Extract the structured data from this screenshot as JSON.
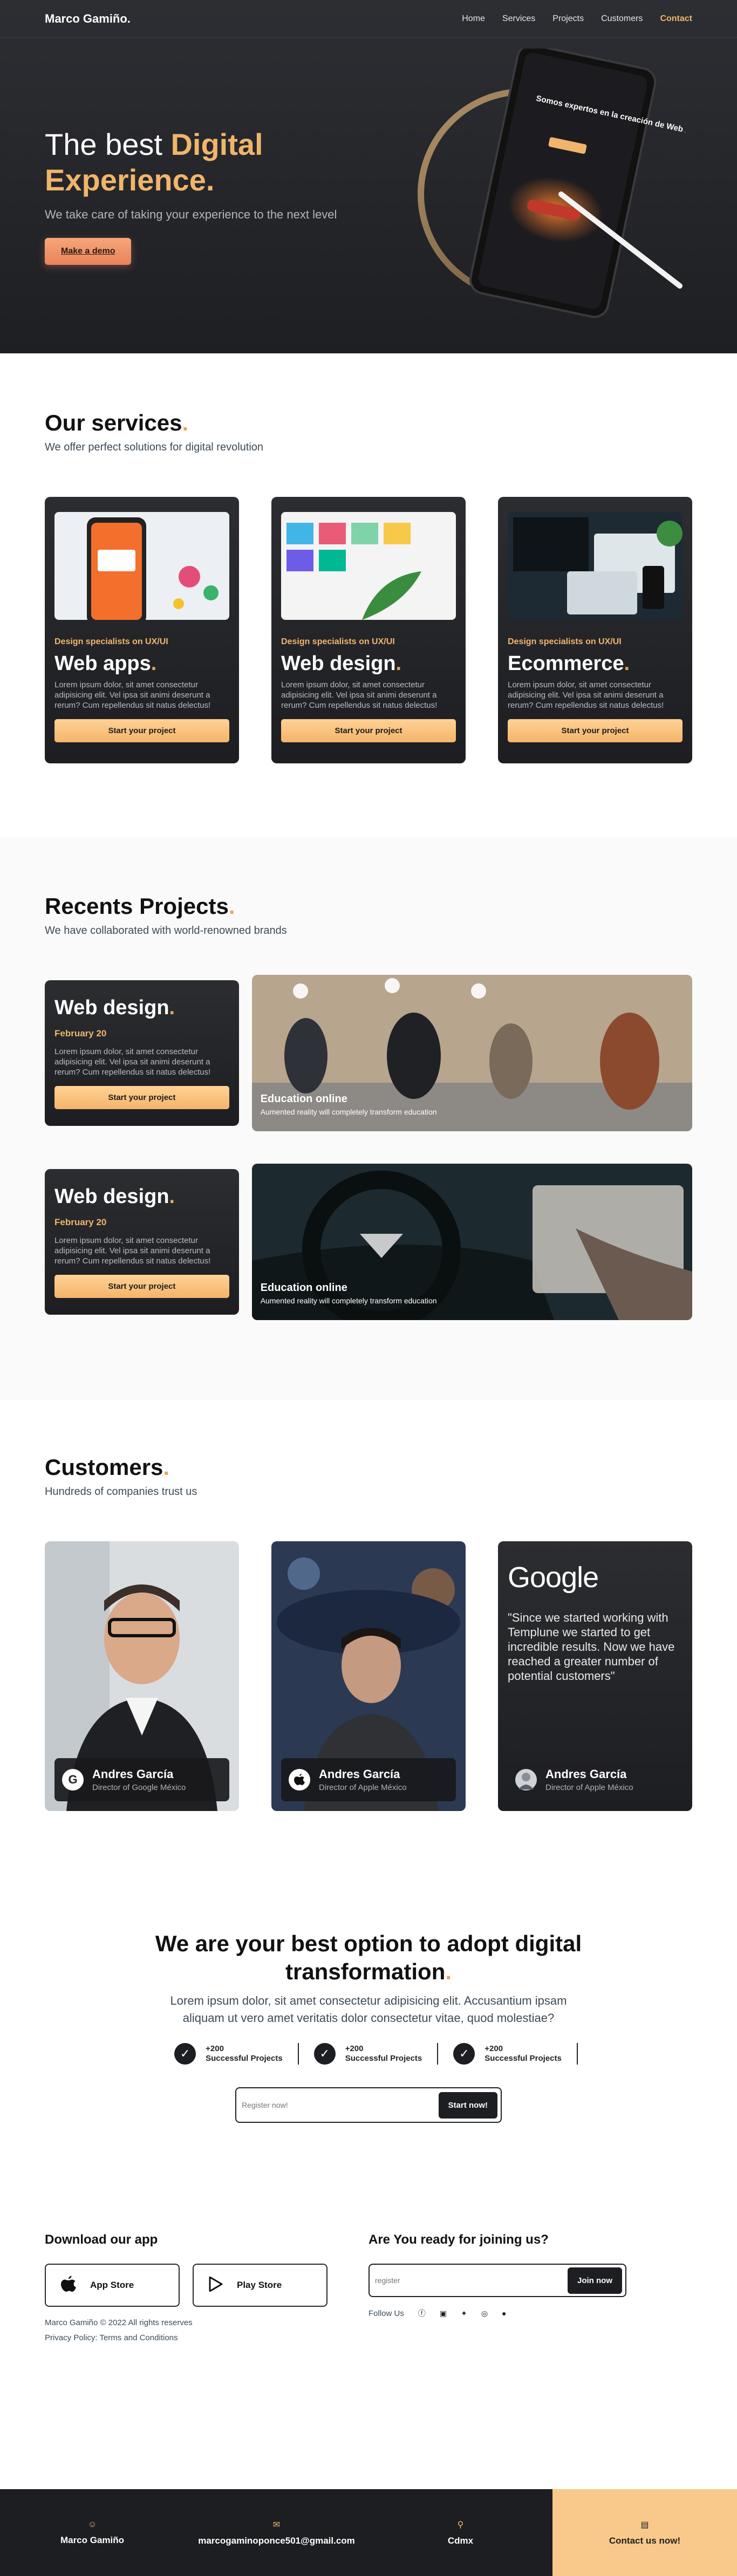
{
  "nav": {
    "brand": "Marco Gamiño.",
    "links": [
      "Home",
      "Services",
      "Projects",
      "Customers"
    ],
    "contact": "Contact"
  },
  "hero": {
    "title_plain": "The best ",
    "title_accent": "Digital Experience.",
    "subtitle": "We take care of taking your experience to the next level",
    "cta": "Make a demo",
    "tablet_text": "Somos expertos en la creación de Web Apps."
  },
  "services": {
    "title": "Our services",
    "subtitle": "We offer perfect solutions for digital revolution",
    "items": [
      {
        "kicker": "Design specialists on UX/UI",
        "title": "Web apps",
        "desc": "Lorem ipsum dolor, sit amet consectetur adipisicing elit. Vel ipsa sit animi deserunt a rerum? Cum repellendus sit natus delectus!",
        "button": "Start your project"
      },
      {
        "kicker": "Design specialists on UX/UI",
        "title": "Web design",
        "desc": "Lorem ipsum dolor, sit amet consectetur adipisicing elit. Vel ipsa sit animi deserunt a rerum? Cum repellendus sit natus delectus!",
        "button": "Start your project"
      },
      {
        "kicker": "Design specialists on UX/UI",
        "title": "Ecommerce",
        "desc": "Lorem ipsum dolor, sit amet consectetur adipisicing elit. Vel ipsa sit animi deserunt a rerum? Cum repellendus sit natus delectus!",
        "button": "Start your project"
      }
    ]
  },
  "projects": {
    "title": "Recents Projects",
    "subtitle": "We have collaborated with world-renowned brands",
    "items": [
      {
        "title": "Web design",
        "date": "February 20",
        "desc": "Lorem ipsum dolor, sit amet consectetur adipisicing elit. Vel ipsa sit animi deserunt a rerum? Cum repellendus sit natus delectus!",
        "button": "Start your project",
        "caption_title": "Education online",
        "caption_sub": "Aumented reality will completely transform education"
      },
      {
        "title": "Web design",
        "date": "February 20",
        "desc": "Lorem ipsum dolor, sit amet consectetur adipisicing elit. Vel ipsa sit animi deserunt a rerum? Cum repellendus sit natus delectus!",
        "button": "Start your project",
        "caption_title": "Education online",
        "caption_sub": "Aumented reality will completely transform education"
      }
    ]
  },
  "customers": {
    "title": "Customers",
    "subtitle": "Hundreds of companies trust us",
    "items": [
      {
        "name": "Andres García",
        "role": "Director of Google México",
        "logo": "G"
      },
      {
        "name": "Andres García",
        "role": "Director of Apple México",
        "logo": ""
      }
    ],
    "quote_card": {
      "brand": "Google",
      "quote": "\"Since we started working with Templune we started to get incredible results. Now we have reached a greater number of potential customers\"",
      "name": "Andres García",
      "role": "Director of Apple México"
    }
  },
  "cta": {
    "title": "We are your best option to adopt digital transformation",
    "subtitle": "Lorem ipsum dolor, sit amet consectetur adipisicing elit. Accusantium ipsam aliquam ut vero amet veritatis dolor consectetur vitae, quod molestiae?",
    "stats": [
      {
        "value": "+200",
        "label": "Successful Projects"
      },
      {
        "value": "+200",
        "label": "Successful Projects"
      },
      {
        "value": "+200",
        "label": "Successful Projects"
      }
    ],
    "input_placeholder": "Register now!",
    "button": "Start now!"
  },
  "footer": {
    "download_title": "Download our app",
    "app_store": "App Store",
    "play_store": "Play Store",
    "copyright": "Marco Gamiño © 2022 All rights reserves",
    "privacy": "Privacy Policy",
    "terms": "Terms and Conditions",
    "join_title": "Are You ready for joining us?",
    "join_placeholder": "register",
    "join_button": "Join now",
    "follow_label": "Follow Us"
  },
  "bottom_bar": {
    "name": "Marco Gamiño",
    "email": "marcogaminoponce501@gmail.com",
    "city": "Cdmx",
    "cta": "Contact us now!"
  },
  "colors": {
    "accent": "#f0b56b",
    "dark": "#1d1e22",
    "demo_button": "#e9825b"
  }
}
